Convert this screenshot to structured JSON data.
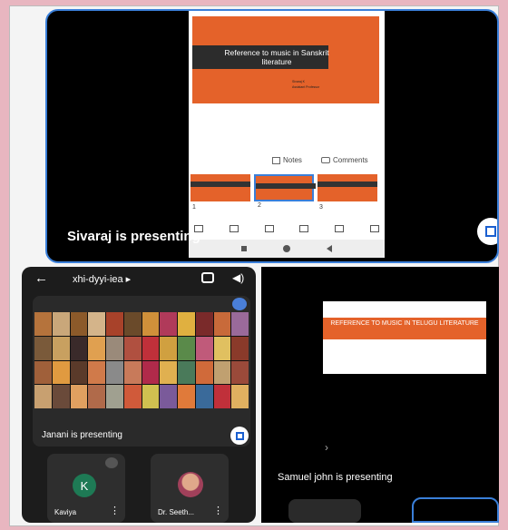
{
  "top_panel": {
    "slide_title": "Reference to music in Sanskrit literature",
    "slide_sub1": "Sivaraj K",
    "slide_sub2": "Assistant Professor",
    "notes_label": "Notes",
    "comments_label": "Comments",
    "thumb_numbers": [
      "1",
      "2",
      "3"
    ],
    "presenting_text": "Sivaraj is presenting"
  },
  "bottom_left": {
    "meeting_code": "xhi-dyyi-iea ▸",
    "presenting_text": "Janani is presenting",
    "participants": [
      {
        "initial": "K",
        "name": "Kaviya"
      },
      {
        "initial": "",
        "name": "Dr. Seeth..."
      }
    ]
  },
  "bottom_right": {
    "slide_title": "REFERENCE TO MUSIC IN TELUGU LITERATURE",
    "presenting_text": "Samuel john is presenting"
  },
  "colors": {
    "accent_blue": "#3a7fd9",
    "slide_orange": "#e4622a",
    "avatar_green": "#1e7a55"
  }
}
